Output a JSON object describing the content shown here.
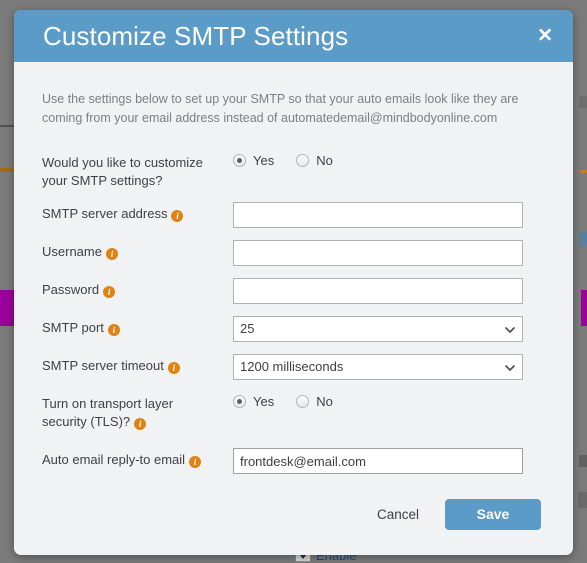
{
  "background": {
    "enable_label": "Enable"
  },
  "modal": {
    "title": "Customize SMTP Settings",
    "close_label": "✕",
    "intro": "Use the settings below to set up your SMTP so that your auto emails look like they are coming from your email address instead of automatedemail@mindbodyonline.com",
    "info_glyph": "i",
    "colors": {
      "header_blue": "#5b9bc8",
      "body_gray": "#f1f2f4",
      "info_orange": "#e08214",
      "backdrop": "#7b7b7b",
      "accent_purple": "#9b019b"
    },
    "rows": {
      "customize": {
        "label_line1": "Would you like to customize",
        "label_line2": "your SMTP settings?",
        "options": [
          {
            "label": "Yes",
            "selected": true
          },
          {
            "label": "No",
            "selected": false
          }
        ]
      },
      "server_address": {
        "label": "SMTP server address",
        "value": "",
        "placeholder": ""
      },
      "username": {
        "label": "Username",
        "value": "",
        "placeholder": ""
      },
      "password": {
        "label": "Password",
        "value": "",
        "placeholder": ""
      },
      "port": {
        "label": "SMTP port",
        "value": "25",
        "options": [
          "25"
        ]
      },
      "timeout": {
        "label": "SMTP server timeout",
        "value": "1200 milliseconds",
        "options": [
          "1200 milliseconds"
        ]
      },
      "tls": {
        "label_line1": "Turn on transport layer",
        "label_line2": "security (TLS)?",
        "options": [
          {
            "label": "Yes",
            "selected": true
          },
          {
            "label": "No",
            "selected": false
          }
        ]
      },
      "reply_to": {
        "label": "Auto email reply-to email",
        "value": "frontdesk@email.com",
        "placeholder": ""
      }
    },
    "footer": {
      "cancel_label": "Cancel",
      "save_label": "Save"
    }
  }
}
